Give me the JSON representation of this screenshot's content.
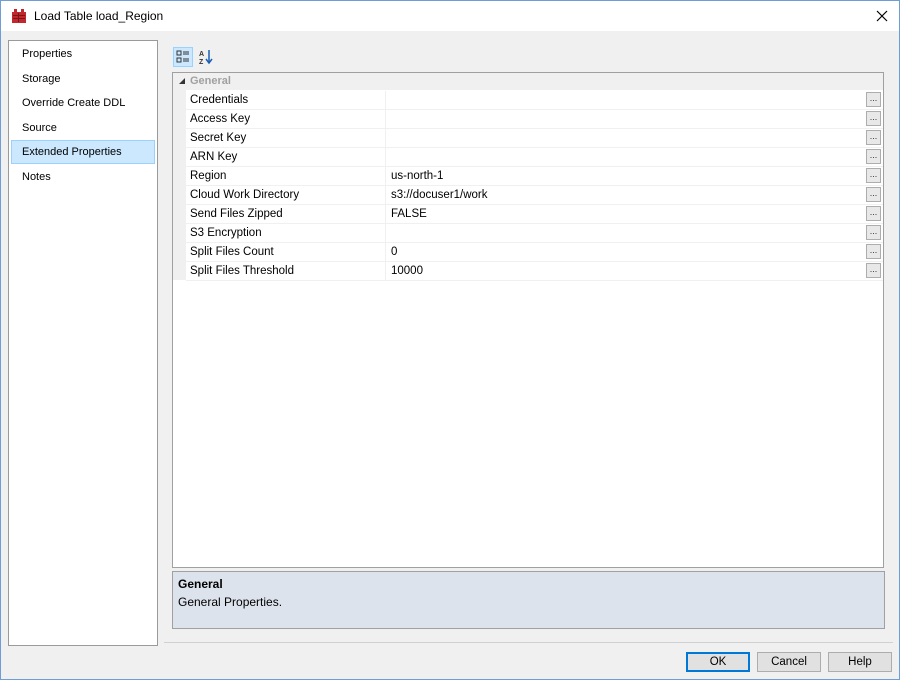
{
  "window": {
    "title": "Load Table load_Region",
    "icon": "table-icon",
    "close_icon": "close-icon"
  },
  "nav": {
    "items": [
      {
        "label": "Properties",
        "selected": false
      },
      {
        "label": "Storage",
        "selected": false
      },
      {
        "label": "Override Create DDL",
        "selected": false
      },
      {
        "label": "Source",
        "selected": false
      },
      {
        "label": "Extended Properties",
        "selected": true
      },
      {
        "label": "Notes",
        "selected": false
      }
    ]
  },
  "toolbar": {
    "categorized_icon": "categorized-icon",
    "alphabetical_icon": "sort-az-icon"
  },
  "grid": {
    "category": "General",
    "rows": [
      {
        "name": "Credentials",
        "value": ""
      },
      {
        "name": "Access Key",
        "value": ""
      },
      {
        "name": "Secret Key",
        "value": ""
      },
      {
        "name": "ARN Key",
        "value": ""
      },
      {
        "name": "Region",
        "value": "us-north-1"
      },
      {
        "name": "Cloud Work Directory",
        "value": "s3://docuser1/work"
      },
      {
        "name": "Send Files Zipped",
        "value": "FALSE"
      },
      {
        "name": "S3 Encryption",
        "value": ""
      },
      {
        "name": "Split Files Count",
        "value": "0"
      },
      {
        "name": "Split Files Threshold",
        "value": "10000"
      }
    ],
    "ellipsis_label": "..."
  },
  "description": {
    "title": "General",
    "text": "General Properties."
  },
  "buttons": {
    "ok": "OK",
    "cancel": "Cancel",
    "help": "Help"
  }
}
